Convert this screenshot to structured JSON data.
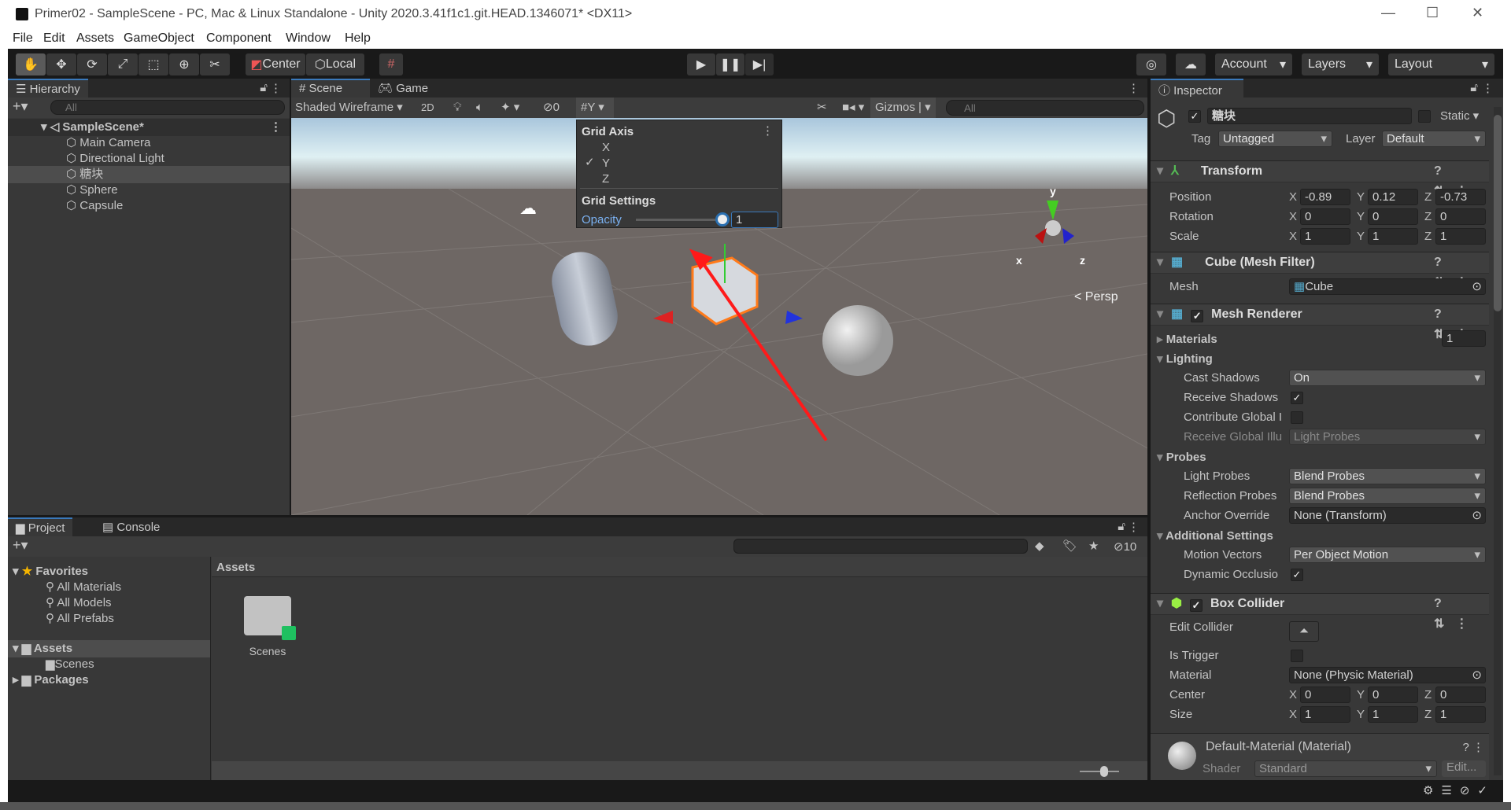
{
  "window": {
    "title": "Primer02 - SampleScene - PC, Mac & Linux Standalone - Unity 2020.3.41f1c1.git.HEAD.1346071* <DX11>",
    "minimize": "—",
    "maximize": "☐",
    "close": "✕"
  },
  "menu": [
    "File",
    "Edit",
    "Assets",
    "GameObject",
    "Component",
    "Window",
    "Help"
  ],
  "toolbar": {
    "pivot": "Center",
    "space": "Local",
    "account": "Account",
    "layers": "Layers",
    "layout": "Layout"
  },
  "hierarchy": {
    "tab": "Hierarchy",
    "search_placeholder": "All",
    "scene": "SampleScene*",
    "items": [
      "Main Camera",
      "Directional Light",
      "糖块",
      "Sphere",
      "Capsule"
    ],
    "selected": "糖块"
  },
  "scene": {
    "tabs": [
      "Scene",
      "Game"
    ],
    "shading": "Shaded Wireframe",
    "mode2d": "2D",
    "hidden_count": "0",
    "gizmos": "Gizmos",
    "search_placeholder": "All",
    "persp": "Persp",
    "axis_labels": [
      "x",
      "y",
      "z"
    ]
  },
  "grid_popup": {
    "axis_title": "Grid Axis",
    "axes": [
      "X",
      "Y",
      "Z"
    ],
    "selected_axis": "Y",
    "settings_title": "Grid Settings",
    "opacity_label": "Opacity",
    "opacity_value": "1",
    "opacity": 1
  },
  "project": {
    "tabs": [
      "Project",
      "Console"
    ],
    "favorites": "Favorites",
    "fav_items": [
      "All Materials",
      "All Models",
      "All Prefabs"
    ],
    "assets": "Assets",
    "asset_children": [
      "Scenes"
    ],
    "packages": "Packages",
    "breadcrumb": "Assets",
    "folder": "Scenes",
    "hidden_count": "10"
  },
  "inspector": {
    "tab": "Inspector",
    "name": "糖块",
    "active": true,
    "static": "Static",
    "tag_label": "Tag",
    "tag": "Untagged",
    "layer_label": "Layer",
    "layer": "Default",
    "transform": {
      "title": "Transform",
      "rows": [
        {
          "label": "Position",
          "x": "-0.89",
          "y": "0.12",
          "z": "-0.73"
        },
        {
          "label": "Rotation",
          "x": "0",
          "y": "0",
          "z": "0"
        },
        {
          "label": "Scale",
          "x": "1",
          "y": "1",
          "z": "1"
        }
      ]
    },
    "mesh_filter": {
      "title": "Cube (Mesh Filter)",
      "mesh_label": "Mesh",
      "mesh": "Cube"
    },
    "mesh_renderer": {
      "title": "Mesh Renderer",
      "materials": "Materials",
      "materials_count": "1",
      "lighting": "Lighting",
      "cast_shadows_label": "Cast Shadows",
      "cast_shadows": "On",
      "receive_shadows": "Receive Shadows",
      "contribute_gi": "Contribute Global I",
      "receive_gi_label": "Receive Global Illu",
      "receive_gi": "Light Probes",
      "probes": "Probes",
      "light_probes_label": "Light Probes",
      "light_probes": "Blend Probes",
      "reflection_probes_label": "Reflection Probes",
      "reflection_probes": "Blend Probes",
      "anchor_label": "Anchor Override",
      "anchor": "None (Transform)",
      "additional": "Additional Settings",
      "motion_label": "Motion Vectors",
      "motion": "Per Object Motion",
      "dynamic_occlusion": "Dynamic Occlusio"
    },
    "box_collider": {
      "title": "Box Collider",
      "edit_collider": "Edit Collider",
      "is_trigger": "Is Trigger",
      "material_label": "Material",
      "material": "None (Physic Material)",
      "center": {
        "label": "Center",
        "x": "0",
        "y": "0",
        "z": "0"
      },
      "size": {
        "label": "Size",
        "x": "1",
        "y": "1",
        "z": "1"
      }
    },
    "material": {
      "title": "Default-Material (Material)",
      "shader_label": "Shader",
      "shader": "Standard",
      "edit": "Edit..."
    }
  },
  "colors": {
    "accent": "#3a79bb",
    "editor_bg": "#383838",
    "annotation_arrow": "#ff1a1a"
  }
}
